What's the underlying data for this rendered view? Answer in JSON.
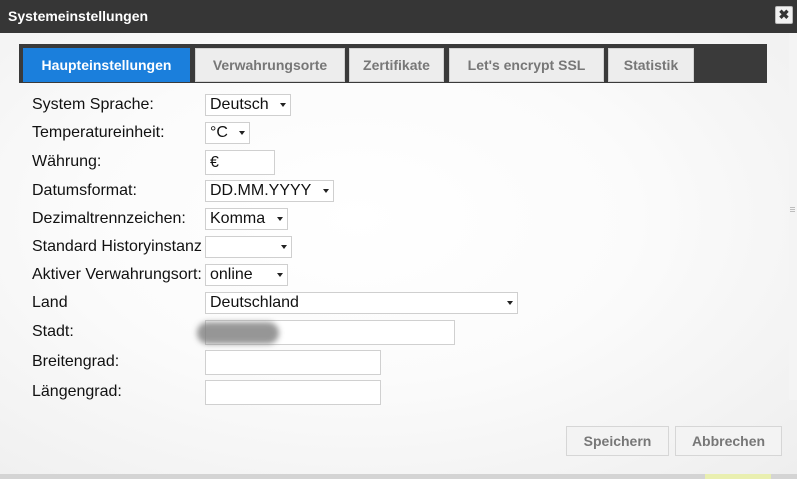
{
  "window": {
    "title": "Systemeinstellungen",
    "close_label": "✖"
  },
  "tabs": [
    {
      "label": "Haupteinstellungen",
      "active": true
    },
    {
      "label": "Verwahrungsorte",
      "active": false
    },
    {
      "label": "Zertifikate",
      "active": false
    },
    {
      "label": "Let's encrypt SSL",
      "active": false
    },
    {
      "label": "Statistik",
      "active": false
    }
  ],
  "form": {
    "system_language": {
      "label": "System Sprache:",
      "value": "Deutsch"
    },
    "temperature_unit": {
      "label": "Temperatureinheit:",
      "value": "°C"
    },
    "currency": {
      "label": "Währung:",
      "value": "€"
    },
    "date_format": {
      "label": "Datumsformat:",
      "value": "DD.MM.YYYY"
    },
    "decimal_separator": {
      "label": "Dezimaltrennzeichen:",
      "value": "Komma"
    },
    "default_history_instance": {
      "label": "Standard Historyinstanz",
      "value": ""
    },
    "active_storage_location": {
      "label": "Aktiver Verwahrungsort:",
      "value": "online"
    },
    "country": {
      "label": "Land",
      "value": "Deutschland"
    },
    "city": {
      "label": "Stadt:",
      "value": ""
    },
    "latitude": {
      "label": "Breitengrad:",
      "value": ""
    },
    "longitude": {
      "label": "Längengrad:",
      "value": ""
    }
  },
  "buttons": {
    "save_label": "Speichern",
    "cancel_label": "Abbrechen"
  },
  "colors": {
    "accent": "#1b7fdc",
    "titlebar": "#363636",
    "tabbar": "#3a3a3a"
  }
}
